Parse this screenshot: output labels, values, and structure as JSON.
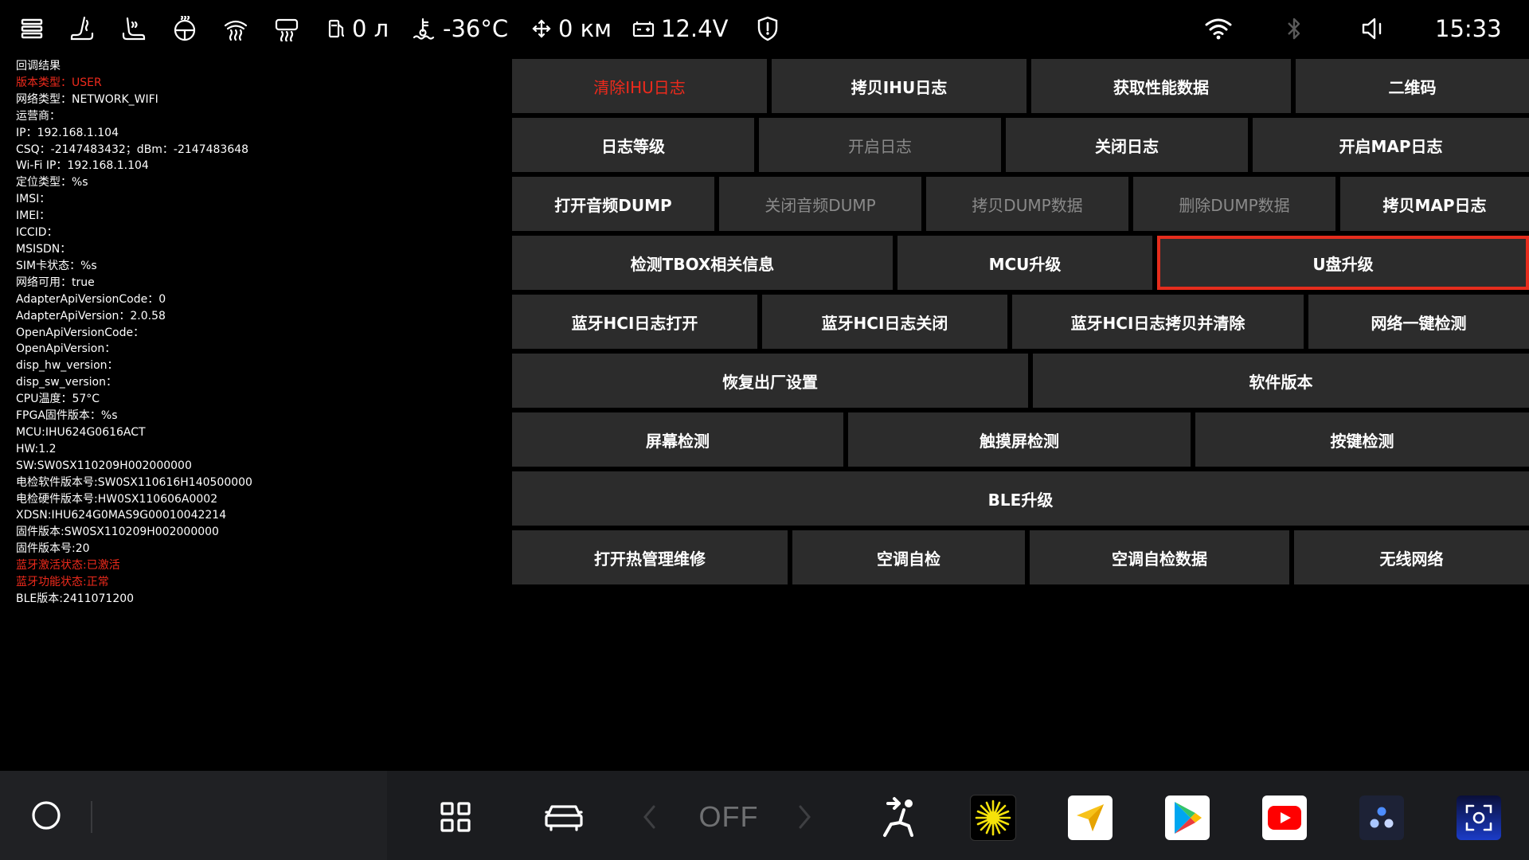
{
  "status_bar": {
    "fuel": "0 л",
    "temperature": "-36°C",
    "distance": "0 км",
    "voltage": "12.4V",
    "time": "15:33"
  },
  "info_panel": {
    "lines": [
      {
        "text": "回调结果",
        "red": false
      },
      {
        "text": "版本类型：USER",
        "red": true
      },
      {
        "text": "网络类型：NETWORK_WIFI",
        "red": false
      },
      {
        "text": "运营商：",
        "red": false
      },
      {
        "text": "IP：192.168.1.104",
        "red": false
      },
      {
        "text": "CSQ：-2147483432；dBm：-2147483648",
        "red": false
      },
      {
        "text": "Wi-Fi IP：192.168.1.104",
        "red": false
      },
      {
        "text": "定位类型：%s",
        "red": false
      },
      {
        "text": "IMSI：",
        "red": false
      },
      {
        "text": "IMEI：",
        "red": false
      },
      {
        "text": "ICCID：",
        "red": false
      },
      {
        "text": "MSISDN：",
        "red": false
      },
      {
        "text": "SIM卡状态：%s",
        "red": false
      },
      {
        "text": "网络可用：true",
        "red": false
      },
      {
        "text": "AdapterApiVersionCode：0",
        "red": false
      },
      {
        "text": "AdapterApiVersion：2.0.58",
        "red": false
      },
      {
        "text": "OpenApiVersionCode：",
        "red": false
      },
      {
        "text": "OpenApiVersion：",
        "red": false
      },
      {
        "text": "disp_hw_version：",
        "red": false
      },
      {
        "text": "disp_sw_version：",
        "red": false
      },
      {
        "text": "CPU温度：57°C",
        "red": false
      },
      {
        "text": "FPGA固件版本：%s",
        "red": false
      },
      {
        "text": "MCU:IHU624G0616ACT",
        "red": false
      },
      {
        "text": "HW:1.2",
        "red": false
      },
      {
        "text": "SW:SW0SX110209H002000000",
        "red": false
      },
      {
        "text": "电检软件版本号:SW0SX110616H140500000",
        "red": false
      },
      {
        "text": "电检硬件版本号:HW0SX110606A0002",
        "red": false
      },
      {
        "text": "XDSN:IHU624G0MAS9G00010042214",
        "red": false
      },
      {
        "text": "固件版本:SW0SX110209H002000000",
        "red": false
      },
      {
        "text": "固件版本号:20",
        "red": false
      },
      {
        "text": "蓝牙激活状态:已激活",
        "red": true
      },
      {
        "text": "蓝牙功能状态:正常",
        "red": true
      },
      {
        "text": "BLE版本:2411071200",
        "red": false
      }
    ]
  },
  "button_rows": [
    [
      {
        "label": "清除IHU日志",
        "state": "warn"
      },
      {
        "label": "拷贝IHU日志",
        "state": "normal"
      },
      {
        "label": "获取性能数据",
        "state": "normal"
      },
      {
        "label": "二维码",
        "state": "normal"
      }
    ],
    [
      {
        "label": "日志等级",
        "state": "normal"
      },
      {
        "label": "开启日志",
        "state": "dim"
      },
      {
        "label": "关闭日志",
        "state": "normal"
      },
      {
        "label": "开启MAP日志",
        "state": "normal"
      }
    ],
    [
      {
        "label": "打开音频DUMP",
        "state": "normal"
      },
      {
        "label": "关闭音频DUMP",
        "state": "dim"
      },
      {
        "label": "拷贝DUMP数据",
        "state": "dim"
      },
      {
        "label": "删除DUMP数据",
        "state": "dim"
      },
      {
        "label": "拷贝MAP日志",
        "state": "normal"
      }
    ],
    [
      {
        "label": "检测TBOX相关信息",
        "state": "normal"
      },
      {
        "label": "MCU升级",
        "state": "normal"
      },
      {
        "label": "U盘升级",
        "state": "selected"
      }
    ],
    [
      {
        "label": "蓝牙HCI日志打开",
        "state": "normal"
      },
      {
        "label": "蓝牙HCI日志关闭",
        "state": "normal"
      },
      {
        "label": "蓝牙HCI日志拷贝并清除",
        "state": "normal"
      },
      {
        "label": "网络一键检测",
        "state": "normal"
      }
    ],
    [
      {
        "label": "恢复出厂设置",
        "state": "normal"
      },
      {
        "label": "软件版本",
        "state": "normal"
      }
    ],
    [
      {
        "label": "屏幕检测",
        "state": "normal"
      },
      {
        "label": "触摸屏检测",
        "state": "normal"
      },
      {
        "label": "按键检测",
        "state": "normal"
      }
    ],
    [
      {
        "label": "BLE升级",
        "state": "normal"
      }
    ],
    [
      {
        "label": "打开热管理维修",
        "state": "normal"
      },
      {
        "label": "空调自检",
        "state": "normal"
      },
      {
        "label": "空调自检数据",
        "state": "normal"
      },
      {
        "label": "无线网络",
        "state": "normal"
      }
    ]
  ],
  "dock": {
    "climate_label": "OFF",
    "apps": [
      "sun-app-icon",
      "navigation-app-icon",
      "play-store-icon",
      "youtube-icon",
      "dots-app-icon",
      "scan-app-icon"
    ]
  },
  "colors": {
    "background": "#000000",
    "button": "#2c2c2c",
    "warning_text": "#ee2a1c",
    "selection_border": "#e52d1d",
    "dock": "#1b1c1f"
  }
}
